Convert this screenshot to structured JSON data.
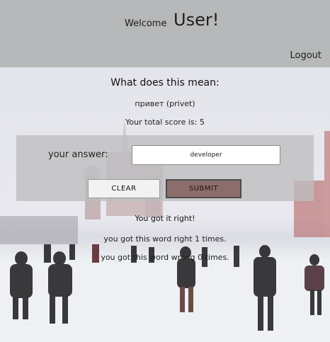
{
  "header": {
    "welcome": "Welcome",
    "user": "User!",
    "logout": "Logout"
  },
  "quiz": {
    "question": "What does this mean:",
    "word": "привет (privet)",
    "score_text": "Your total score is: 5",
    "answer_label": "your answer:",
    "answer_value": "developer",
    "clear_label": "CLEAR",
    "submit_label": "SUBMIT",
    "result": "You got it right!",
    "stats_right": "you got this word right 1 times.",
    "stats_wrong": "you got this word wrong 0 times."
  },
  "colors": {
    "header_bg": "#b6b8b9",
    "submit_bg": "#8c6d6b",
    "panel_bg": "#bebec0"
  }
}
